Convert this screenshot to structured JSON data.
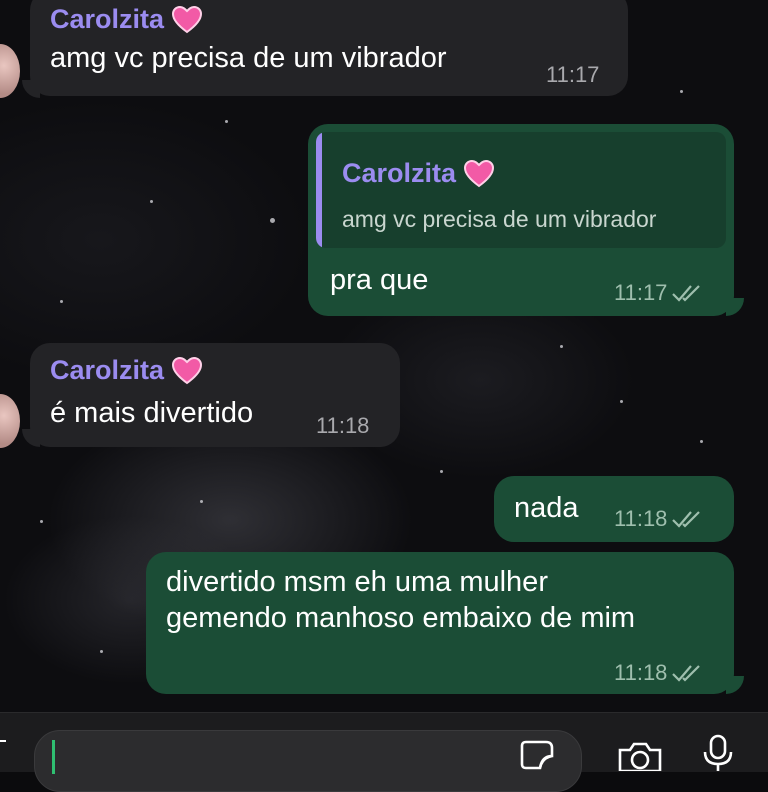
{
  "contact": {
    "name": "Carolzita",
    "heart": "💗"
  },
  "messages": [
    {
      "dir": "in",
      "sender": "Carolzita",
      "text": "amg vc precisa de um vibrador",
      "time": "11:17"
    },
    {
      "dir": "out",
      "reply_to": {
        "sender": "Carolzita",
        "text": "amg vc precisa de um vibrador"
      },
      "text": "pra que",
      "time": "11:17",
      "status": "read"
    },
    {
      "dir": "in",
      "sender": "Carolzita",
      "text": "é mais divertido",
      "time": "11:18"
    },
    {
      "dir": "out",
      "text": "nada",
      "time": "11:18",
      "status": "read"
    },
    {
      "dir": "out",
      "text": "divertido msm eh uma mulher\ngemendo manhoso embaixo de mim",
      "time": "11:18",
      "status": "read"
    }
  ],
  "composer": {
    "placeholder": "",
    "icons": [
      "sticker-icon",
      "camera-icon",
      "microphone-icon"
    ]
  },
  "colors": {
    "incoming": "#232326",
    "outgoing": "#1b4d36",
    "sender_name": "#9b8cf0",
    "background": "#0d0d10"
  }
}
